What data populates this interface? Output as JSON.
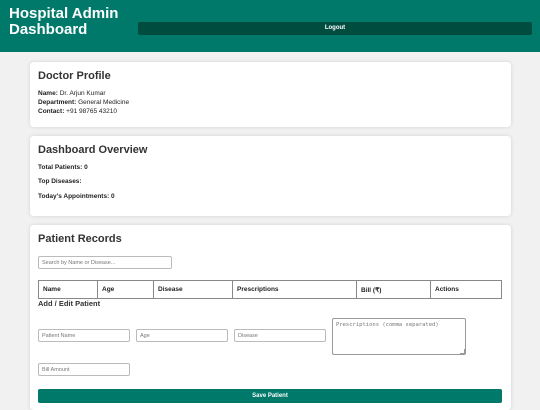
{
  "header": {
    "title": "Hospital Admin Dashboard",
    "logout_label": "Logout"
  },
  "doctor_profile": {
    "title": "Doctor Profile",
    "name_label": "Name:",
    "name_value": "Dr. Arjun Kumar",
    "department_label": "Department:",
    "department_value": "General Medicine",
    "contact_label": "Contact:",
    "contact_value": "+91 98765 43210"
  },
  "overview": {
    "title": "Dashboard Overview",
    "total_patients": "Total Patients: 0",
    "top_diseases": "Top Diseases:",
    "todays_appointments": "Today's Appointments: 0"
  },
  "records": {
    "title": "Patient Records",
    "search_placeholder": "Search by Name or Disease...",
    "columns": [
      "Name",
      "Age",
      "Disease",
      "Prescriptions",
      "Bill (₹)",
      "Actions"
    ]
  },
  "form": {
    "title": "Add / Edit Patient",
    "patient_name_placeholder": "Patient Name",
    "age_placeholder": "Age",
    "disease_placeholder": "Disease",
    "prescriptions_placeholder": "Prescriptions (comma separated)",
    "bill_placeholder": "Bill Amount",
    "save_label": "Save Patient"
  },
  "colors": {
    "header_bg": "#00796b",
    "logout_bg": "#004d40",
    "primary_button": "#00796b",
    "page_bg": "#f1f1f1"
  }
}
